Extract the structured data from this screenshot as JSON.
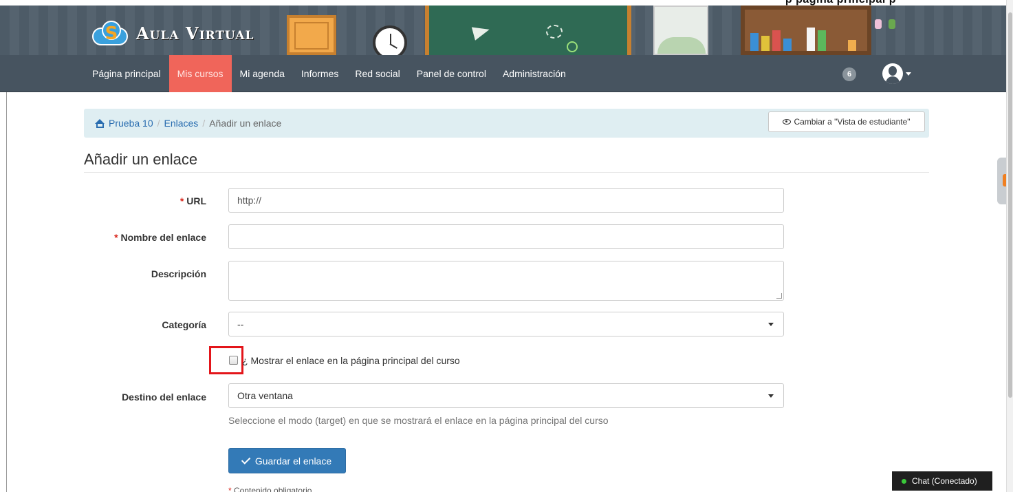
{
  "banner": {
    "logo_text": "Aula Virtual",
    "truncated_heading": "p                                            página principal p"
  },
  "navbar": {
    "items": [
      {
        "label": "Página principal",
        "active": false
      },
      {
        "label": "Mis cursos",
        "active": true
      },
      {
        "label": "Mi agenda",
        "active": false
      },
      {
        "label": "Informes",
        "active": false
      },
      {
        "label": "Red social",
        "active": false
      },
      {
        "label": "Panel de control",
        "active": false
      },
      {
        "label": "Administración",
        "active": false
      }
    ],
    "notification_count": "6",
    "active_color": "#f0655a",
    "bar_color": "#475460"
  },
  "breadcrumb": {
    "home": "Prueba 10",
    "section": "Enlaces",
    "current": "Añadir un enlace",
    "separator": "/"
  },
  "student_view_button": "Cambiar a \"Vista de estudiante\"",
  "page_title": "Añadir un enlace",
  "form": {
    "required_mark": "*",
    "url_label": "URL",
    "url_value": "http://",
    "name_label": "Nombre del enlace",
    "name_value": "",
    "description_label": "Descripción",
    "category_label": "Categoría",
    "category_value": "--",
    "show_on_homepage_label": "¿ Mostrar el enlace en la página principal del curso",
    "show_on_homepage_checked": false,
    "target_label": "Destino del enlace",
    "target_value": "Otra ventana",
    "target_help": "Seleccione el modo (target) en que se mostrará el enlace en la página principal del curso",
    "save_button": "Guardar el enlace",
    "required_footnote": "Contenido obligatorio"
  },
  "chat": {
    "label": "Chat (Conectado)",
    "status_color": "#3ac93a"
  },
  "icons": [
    "home-icon",
    "eye-icon",
    "check-icon",
    "avatar-icon",
    "caret-down-icon",
    "chat-status-icon"
  ]
}
